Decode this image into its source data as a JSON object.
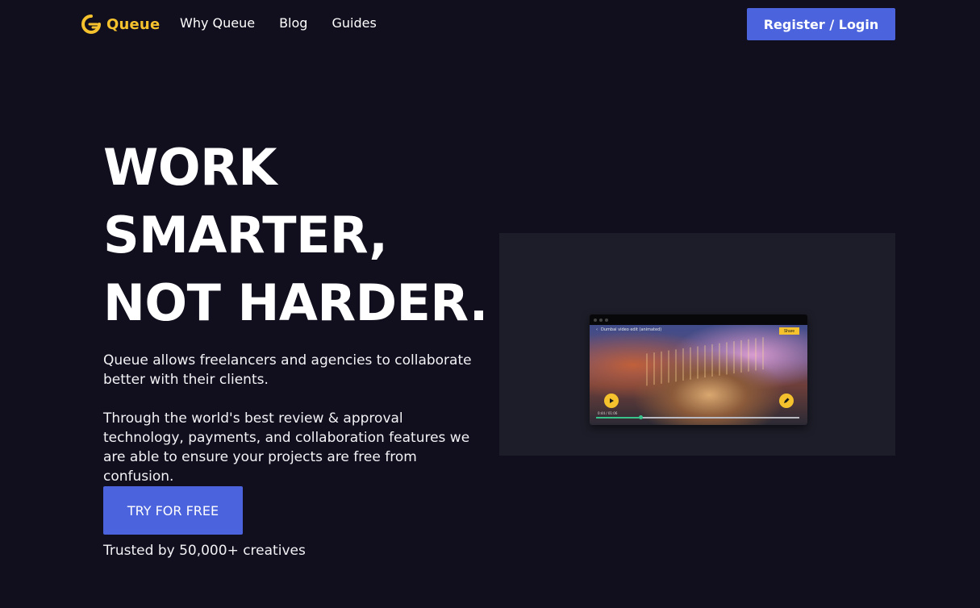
{
  "nav": {
    "logo_text": "Queue",
    "links": [
      "Why Queue",
      "Blog",
      "Guides"
    ],
    "login_label": "Register / Login"
  },
  "hero": {
    "title_lines": [
      "WORK",
      "SMARTER,",
      "NOT HARDER."
    ],
    "paragraph_1": "Queue allows freelancers and agencies to collaborate better with their clients.",
    "paragraph_2": "Through the world's best review & approval technology, payments, and collaboration features we are able to ensure your projects are free from confusion.",
    "cta_label": "TRY FOR FREE",
    "trusted_text": "Trusted by 50,000+ creatives"
  },
  "preview": {
    "video_title": "Dumbai video edit (animated)",
    "share_label": "Share",
    "timecode": "0:44 / 01:06",
    "progress": 0.22
  },
  "colors": {
    "background": "#110f1e",
    "accent_blue": "#4b63dc",
    "brand_yellow": "#f5c22e",
    "panel": "#1c1d28"
  },
  "icons": [
    "queue-logo-icon",
    "play-icon",
    "pencil-icon",
    "back-chevron-icon"
  ]
}
